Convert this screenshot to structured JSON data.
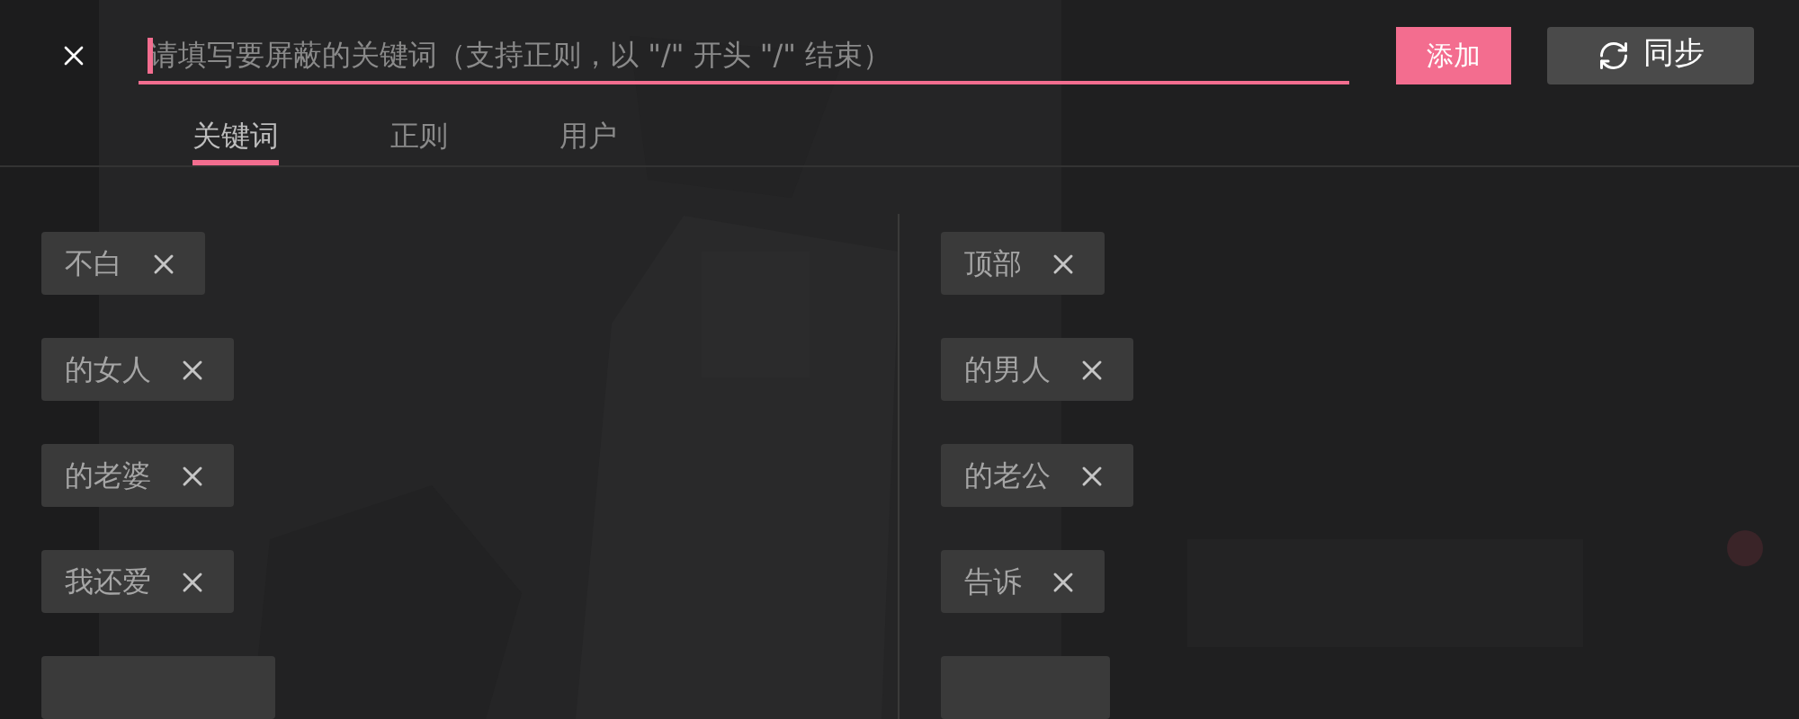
{
  "search": {
    "placeholder": "请填写要屏蔽的关键词（支持正则，以 \"/\" 开头 \"/\" 结束）",
    "focused": true
  },
  "buttons": {
    "add": "添加",
    "sync": "同步"
  },
  "tabs": [
    {
      "label": "关键词",
      "selected": true
    },
    {
      "label": "正则",
      "selected": false
    },
    {
      "label": "用户",
      "selected": false
    }
  ],
  "columns": [
    {
      "tags": [
        "不白",
        "的女人",
        "的老婆",
        "我还爱"
      ],
      "partial_tag": true
    },
    {
      "tags": [
        "顶部",
        "的男人",
        "的老公",
        "告诉"
      ],
      "partial_tag": true
    }
  ]
}
